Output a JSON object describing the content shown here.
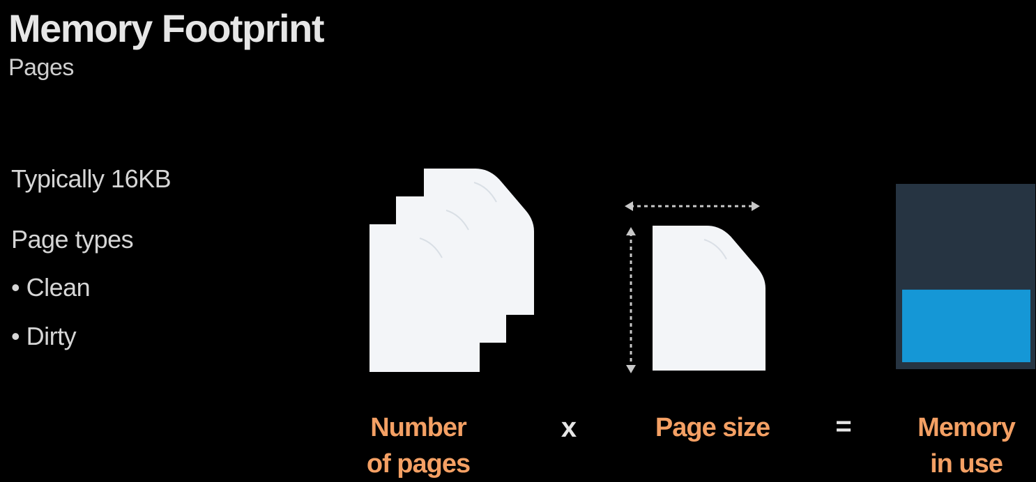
{
  "header": {
    "title": "Memory Footprint",
    "subtitle": "Pages"
  },
  "bullets": [
    {
      "text": "Typically 16KB"
    },
    {
      "text": "Page types"
    },
    {
      "text": "• Clean"
    },
    {
      "text": "• Dirty"
    }
  ],
  "equation": {
    "term1": {
      "line1": "Number",
      "line2": "of pages"
    },
    "operator1": "x",
    "term2": "Page size",
    "operator2": "=",
    "term3": {
      "line1": "Memory",
      "line2": "in use"
    }
  },
  "colors": {
    "background": "#000000",
    "page_fill": "#f3f5f8",
    "label_orange": "#f4a064",
    "memory_total": "#263442",
    "memory_used": "#1597d6"
  },
  "icons": [
    "stacked-pages-icon",
    "single-page-icon",
    "memory-block-icon"
  ],
  "memory_used_fraction": 0.42
}
